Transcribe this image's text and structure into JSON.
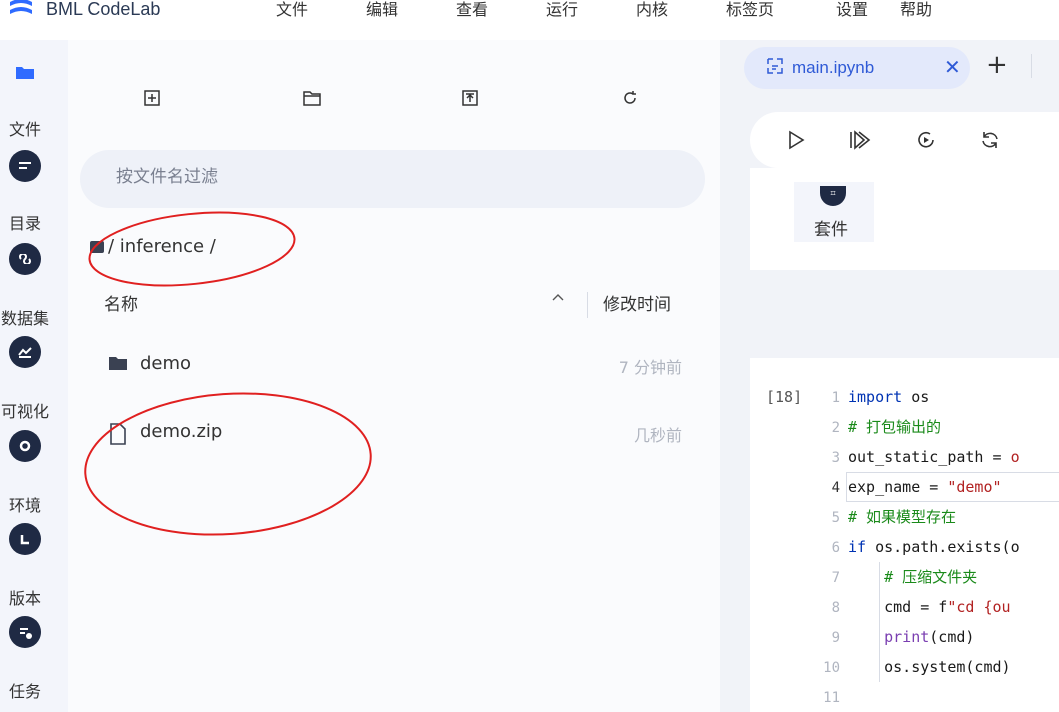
{
  "app": {
    "title": "BML CodeLab",
    "menu": [
      "文件",
      "编辑",
      "查看",
      "运行",
      "内核",
      "标签页",
      "设置",
      "帮助"
    ]
  },
  "activity_bar": [
    {
      "label": "文件",
      "icon": "folder-icon",
      "active": true
    },
    {
      "label": "目录",
      "icon": "list-icon",
      "active": false
    },
    {
      "label": "数据集",
      "icon": "dataset-icon",
      "active": false
    },
    {
      "label": "可视化",
      "icon": "chart-icon",
      "active": false
    },
    {
      "label": "环境",
      "icon": "environment-icon",
      "active": false
    },
    {
      "label": "版本",
      "icon": "version-icon",
      "active": false
    },
    {
      "label": "任务",
      "icon": "task-icon",
      "active": false
    }
  ],
  "file_browser": {
    "toolbar": [
      "new-file-icon",
      "new-folder-icon",
      "upload-icon",
      "refresh-icon"
    ],
    "filter_placeholder": "按文件名过滤",
    "breadcrumb": "/ inference /",
    "columns": {
      "name": "名称",
      "modified": "修改时间"
    },
    "items": [
      {
        "name": "demo",
        "type": "folder",
        "modified": "7 分钟前"
      },
      {
        "name": "demo.zip",
        "type": "file",
        "modified": "几秒前"
      }
    ]
  },
  "notebook": {
    "tab_label": "main.ipynb",
    "toolbar": [
      "run-icon",
      "run-all-icon",
      "restart-run-icon",
      "restart-icon"
    ],
    "kit_label": "套件",
    "cell": {
      "exec_count": "[18]",
      "current_line": 4,
      "lines": [
        {
          "n": "1",
          "tokens": [
            {
              "t": "import",
              "c": "kw"
            },
            {
              "t": " os",
              "c": "code-text"
            }
          ]
        },
        {
          "n": "2",
          "tokens": [
            {
              "t": "# 打包输出的",
              "c": "cm"
            }
          ]
        },
        {
          "n": "3",
          "tokens": [
            {
              "t": "out_static_path = ",
              "c": "code-text"
            },
            {
              "t": "o",
              "c": "str"
            }
          ]
        },
        {
          "n": "4",
          "tokens": [
            {
              "t": "exp_name = ",
              "c": "code-text"
            },
            {
              "t": "\"demo\"",
              "c": "str"
            }
          ]
        },
        {
          "n": "5",
          "tokens": [
            {
              "t": "# 如果模型存在",
              "c": "cm"
            }
          ]
        },
        {
          "n": "6",
          "tokens": [
            {
              "t": "if",
              "c": "kw"
            },
            {
              "t": " os.path.exists(",
              "c": "code-text"
            },
            {
              "t": "o",
              "c": "code-text"
            }
          ]
        },
        {
          "n": "7",
          "tokens": [
            {
              "t": "    # 压缩文件夹",
              "c": "cm"
            }
          ]
        },
        {
          "n": "8",
          "tokens": [
            {
              "t": "    cmd = f",
              "c": "code-text"
            },
            {
              "t": "\"cd {ou",
              "c": "str"
            }
          ]
        },
        {
          "n": "9",
          "tokens": [
            {
              "t": "    ",
              "c": "code-text"
            },
            {
              "t": "print",
              "c": "fn"
            },
            {
              "t": "(cmd)",
              "c": "code-text"
            }
          ]
        },
        {
          "n": "10",
          "tokens": [
            {
              "t": "    os.system(cmd)",
              "c": "code-text"
            }
          ]
        },
        {
          "n": "11",
          "tokens": []
        }
      ]
    }
  },
  "colors": {
    "accent": "#2f6bff",
    "annotation": "#e02020",
    "icon_dark": "#1f2a44"
  }
}
